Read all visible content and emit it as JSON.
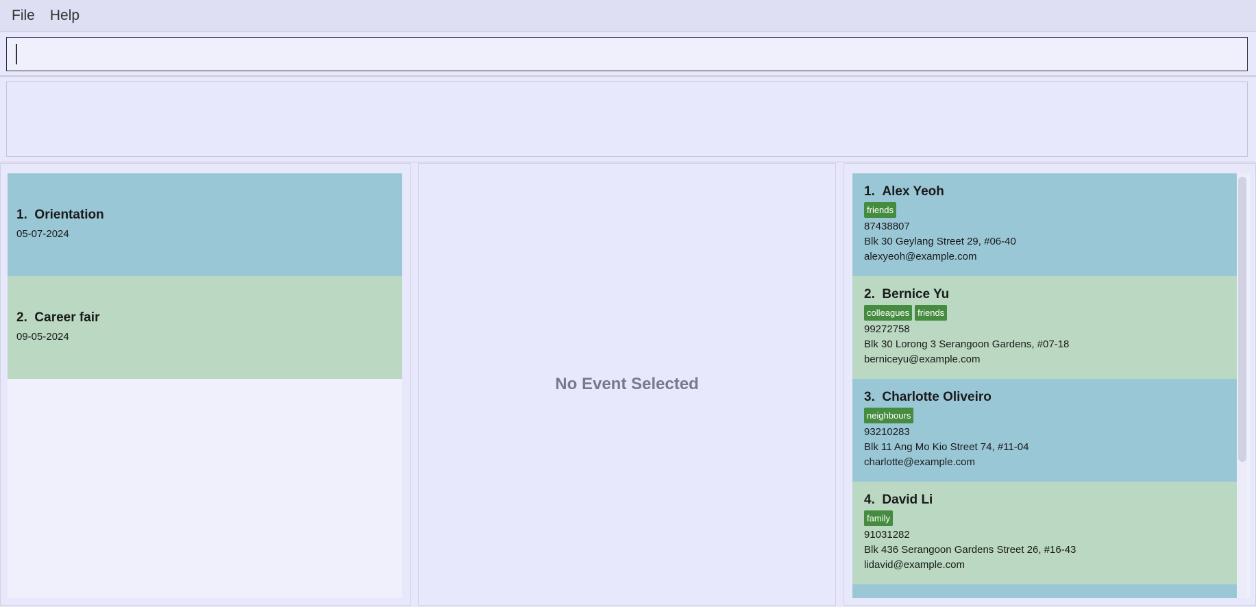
{
  "menu": {
    "items": [
      "File",
      "Help"
    ]
  },
  "command_box": {
    "value": ""
  },
  "result_display": {
    "text": ""
  },
  "events": [
    {
      "index": "1.",
      "name": "Orientation",
      "date": "05-07-2024"
    },
    {
      "index": "2.",
      "name": "Career fair",
      "date": "09-05-2024"
    }
  ],
  "event_detail": {
    "empty_text": "No Event Selected"
  },
  "persons": [
    {
      "index": "1.",
      "name": "Alex Yeoh",
      "tags": [
        "friends"
      ],
      "phone": "87438807",
      "address": "Blk 30 Geylang Street 29, #06-40",
      "email": "alexyeoh@example.com"
    },
    {
      "index": "2.",
      "name": "Bernice Yu",
      "tags": [
        "colleagues",
        "friends"
      ],
      "phone": "99272758",
      "address": "Blk 30 Lorong 3 Serangoon Gardens, #07-18",
      "email": "berniceyu@example.com"
    },
    {
      "index": "3.",
      "name": "Charlotte Oliveiro",
      "tags": [
        "neighbours"
      ],
      "phone": "93210283",
      "address": "Blk 11 Ang Mo Kio Street 74, #11-04",
      "email": "charlotte@example.com"
    },
    {
      "index": "4.",
      "name": "David Li",
      "tags": [
        "family"
      ],
      "phone": "91031282",
      "address": "Blk 436 Serangoon Gardens Street 26, #16-43",
      "email": "lidavid@example.com"
    }
  ],
  "colors": {
    "card_odd": "#9ac7d6",
    "card_even": "#bad8c2",
    "tag": "#468c40",
    "background": "#e8e8fc"
  }
}
